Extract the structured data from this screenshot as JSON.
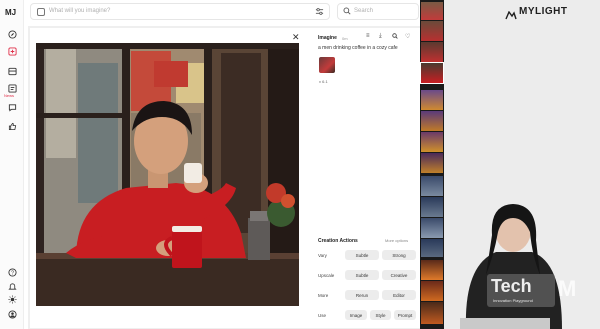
{
  "app": {
    "logo": "MJ",
    "news_label": "News"
  },
  "topbar": {
    "prompt_placeholder": "What will you imagine?",
    "search_placeholder": "Search"
  },
  "icons": {
    "explore": "compass-icon",
    "create": "create-icon",
    "organize": "archive-icon",
    "news": "news-icon",
    "chat": "chat-icon",
    "likes": "thumbs-up-icon",
    "help": "help-icon",
    "updates": "bell-icon",
    "settings": "sun-icon",
    "profile": "user-icon",
    "image": "image-icon",
    "tune": "sliders-icon",
    "search": "search-icon",
    "close": "close-icon",
    "options": "options-icon",
    "download": "download-icon",
    "lookup": "magnify-icon",
    "like": "heart-icon"
  },
  "detail": {
    "section": "Imagine",
    "time": "0m",
    "prompt": "a men drinking coffee in a cozy cafe",
    "version": "v 6.1"
  },
  "creation_actions": {
    "title": "Creation Actions",
    "more": "More options",
    "rows": [
      {
        "label": "Vary",
        "buttons": [
          "Subtle",
          "Strong"
        ]
      },
      {
        "label": "Upscale",
        "buttons": [
          "Subtle",
          "Creative"
        ]
      },
      {
        "label": "More",
        "buttons": [
          "Rerun",
          "Editor"
        ]
      },
      {
        "label": "Use",
        "buttons": [
          "Image",
          "Style",
          "Prompt"
        ]
      }
    ]
  },
  "brand": {
    "name": "MYLIGHT"
  },
  "watermark": {
    "big": "Tech",
    "small": "Innovation Playground",
    "tail": "M"
  },
  "colors": {
    "accent_red": "#e0304a",
    "shirt_red": "#c81e22",
    "mug_red": "#c0141c"
  }
}
